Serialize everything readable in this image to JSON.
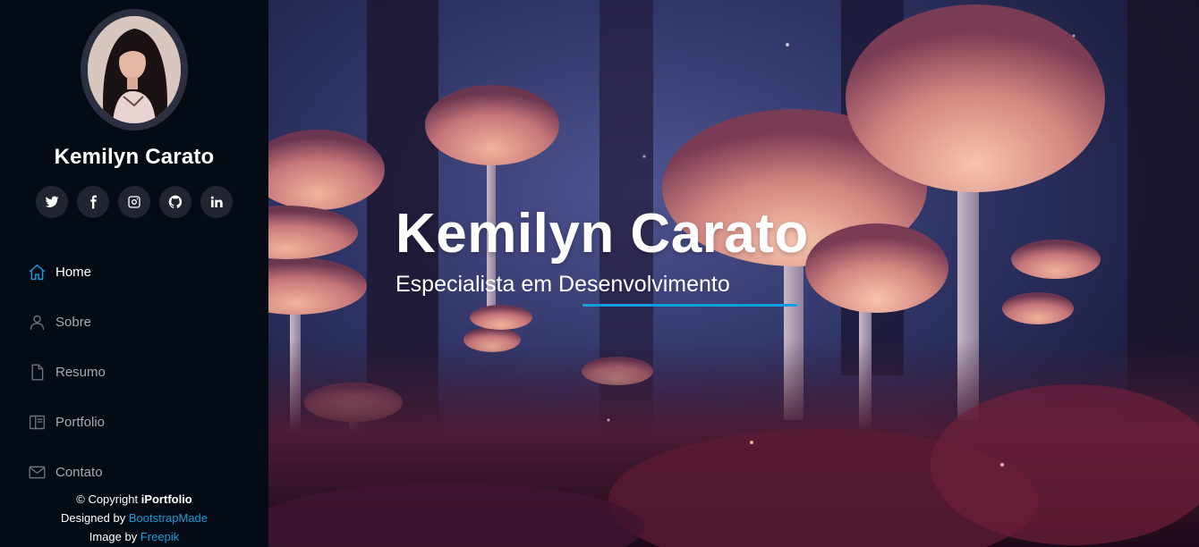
{
  "profile": {
    "name": "Kemilyn Carato"
  },
  "social": [
    {
      "icon": "twitter-icon",
      "name": "twitter-link"
    },
    {
      "icon": "facebook-icon",
      "name": "facebook-link"
    },
    {
      "icon": "instagram-icon",
      "name": "instagram-link"
    },
    {
      "icon": "github-icon",
      "name": "github-link"
    },
    {
      "icon": "linkedin-icon",
      "name": "linkedin-link"
    }
  ],
  "nav": {
    "items": [
      {
        "label": "Home",
        "icon": "home-icon",
        "active": true
      },
      {
        "label": "Sobre",
        "icon": "person-icon",
        "active": false
      },
      {
        "label": "Resumo",
        "icon": "file-icon",
        "active": false
      },
      {
        "label": "Portfolio",
        "icon": "book-icon",
        "active": false
      },
      {
        "label": "Contato",
        "icon": "envelope-icon",
        "active": false
      }
    ]
  },
  "footer": {
    "copyright_prefix": "© Copyright ",
    "brand": "iPortfolio",
    "designed_prefix": "Designed by ",
    "designed_link": "BootstrapMade",
    "image_prefix": "Image by ",
    "image_link": "Freepik"
  },
  "hero": {
    "title": "Kemilyn Carato",
    "subtitle": "Especialista em Desenvolvimento"
  },
  "colors": {
    "accent": "#149ddd",
    "sidebar_bg": "#040b14",
    "social_bg": "#212431"
  }
}
